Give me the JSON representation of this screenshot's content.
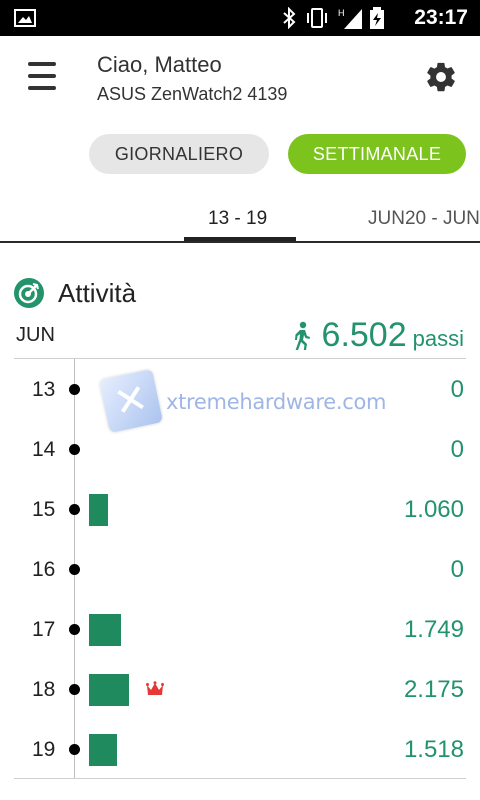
{
  "status_bar": {
    "time": "23:17",
    "icons": [
      "image-icon",
      "bluetooth-icon",
      "vibrate-icon",
      "signal-icon",
      "battery-charging-icon"
    ],
    "network_label": "H"
  },
  "header": {
    "greeting": "Ciao, Matteo",
    "device": "ASUS ZenWatch2 4139",
    "menu_icon": "hamburger-menu-icon",
    "settings_icon": "gear-icon"
  },
  "mode_toggle": {
    "daily_label": "GIORNALIERO",
    "weekly_label": "SETTIMANALE",
    "selected": "SETTIMANALE"
  },
  "date_tabs": {
    "active": "13 - 19",
    "next": "JUN20 - JUN"
  },
  "activity": {
    "title": "Attività",
    "month": "JUN",
    "total_steps": "6.502",
    "steps_unit": "passi",
    "days": [
      {
        "day": "13",
        "value_text": "0",
        "steps": 0,
        "best": false
      },
      {
        "day": "14",
        "value_text": "0",
        "steps": 0,
        "best": false
      },
      {
        "day": "15",
        "value_text": "1.060",
        "steps": 1060,
        "best": false
      },
      {
        "day": "16",
        "value_text": "0",
        "steps": 0,
        "best": false
      },
      {
        "day": "17",
        "value_text": "1.749",
        "steps": 1749,
        "best": false
      },
      {
        "day": "18",
        "value_text": "2.175",
        "steps": 2175,
        "best": true
      },
      {
        "day": "19",
        "value_text": "1.518",
        "steps": 1518,
        "best": false
      }
    ]
  },
  "watermark": {
    "text": "xtremehardware.com"
  },
  "colors": {
    "accent_green": "#7cc31e",
    "steps_green": "#22936b",
    "bar_green": "#1f8a5e",
    "crown_red": "#e53935"
  }
}
